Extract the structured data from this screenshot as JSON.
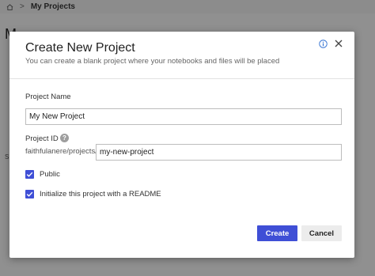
{
  "background": {
    "breadcrumb": {
      "separator": ">",
      "current": "My Projects"
    },
    "heading_partial": "M",
    "side_letter": "S"
  },
  "dialog": {
    "title": "Create New Project",
    "subtitle": "You can create a blank project where your notebooks and files will be placed",
    "info_icon": "info-icon",
    "close_icon": "close-icon",
    "project_name": {
      "label": "Project Name",
      "value": "My New Project"
    },
    "project_id": {
      "label": "Project ID",
      "help_glyph": "?",
      "prefix": "faithfulanere/projects/",
      "value": "my-new-project"
    },
    "options": [
      {
        "label": "Public",
        "checked": true
      },
      {
        "label": "Initialize this project with a README",
        "checked": true
      }
    ],
    "buttons": {
      "create": "Create",
      "cancel": "Cancel"
    }
  },
  "colors": {
    "accent": "#3f4fd6",
    "info": "#2f6fd1"
  }
}
